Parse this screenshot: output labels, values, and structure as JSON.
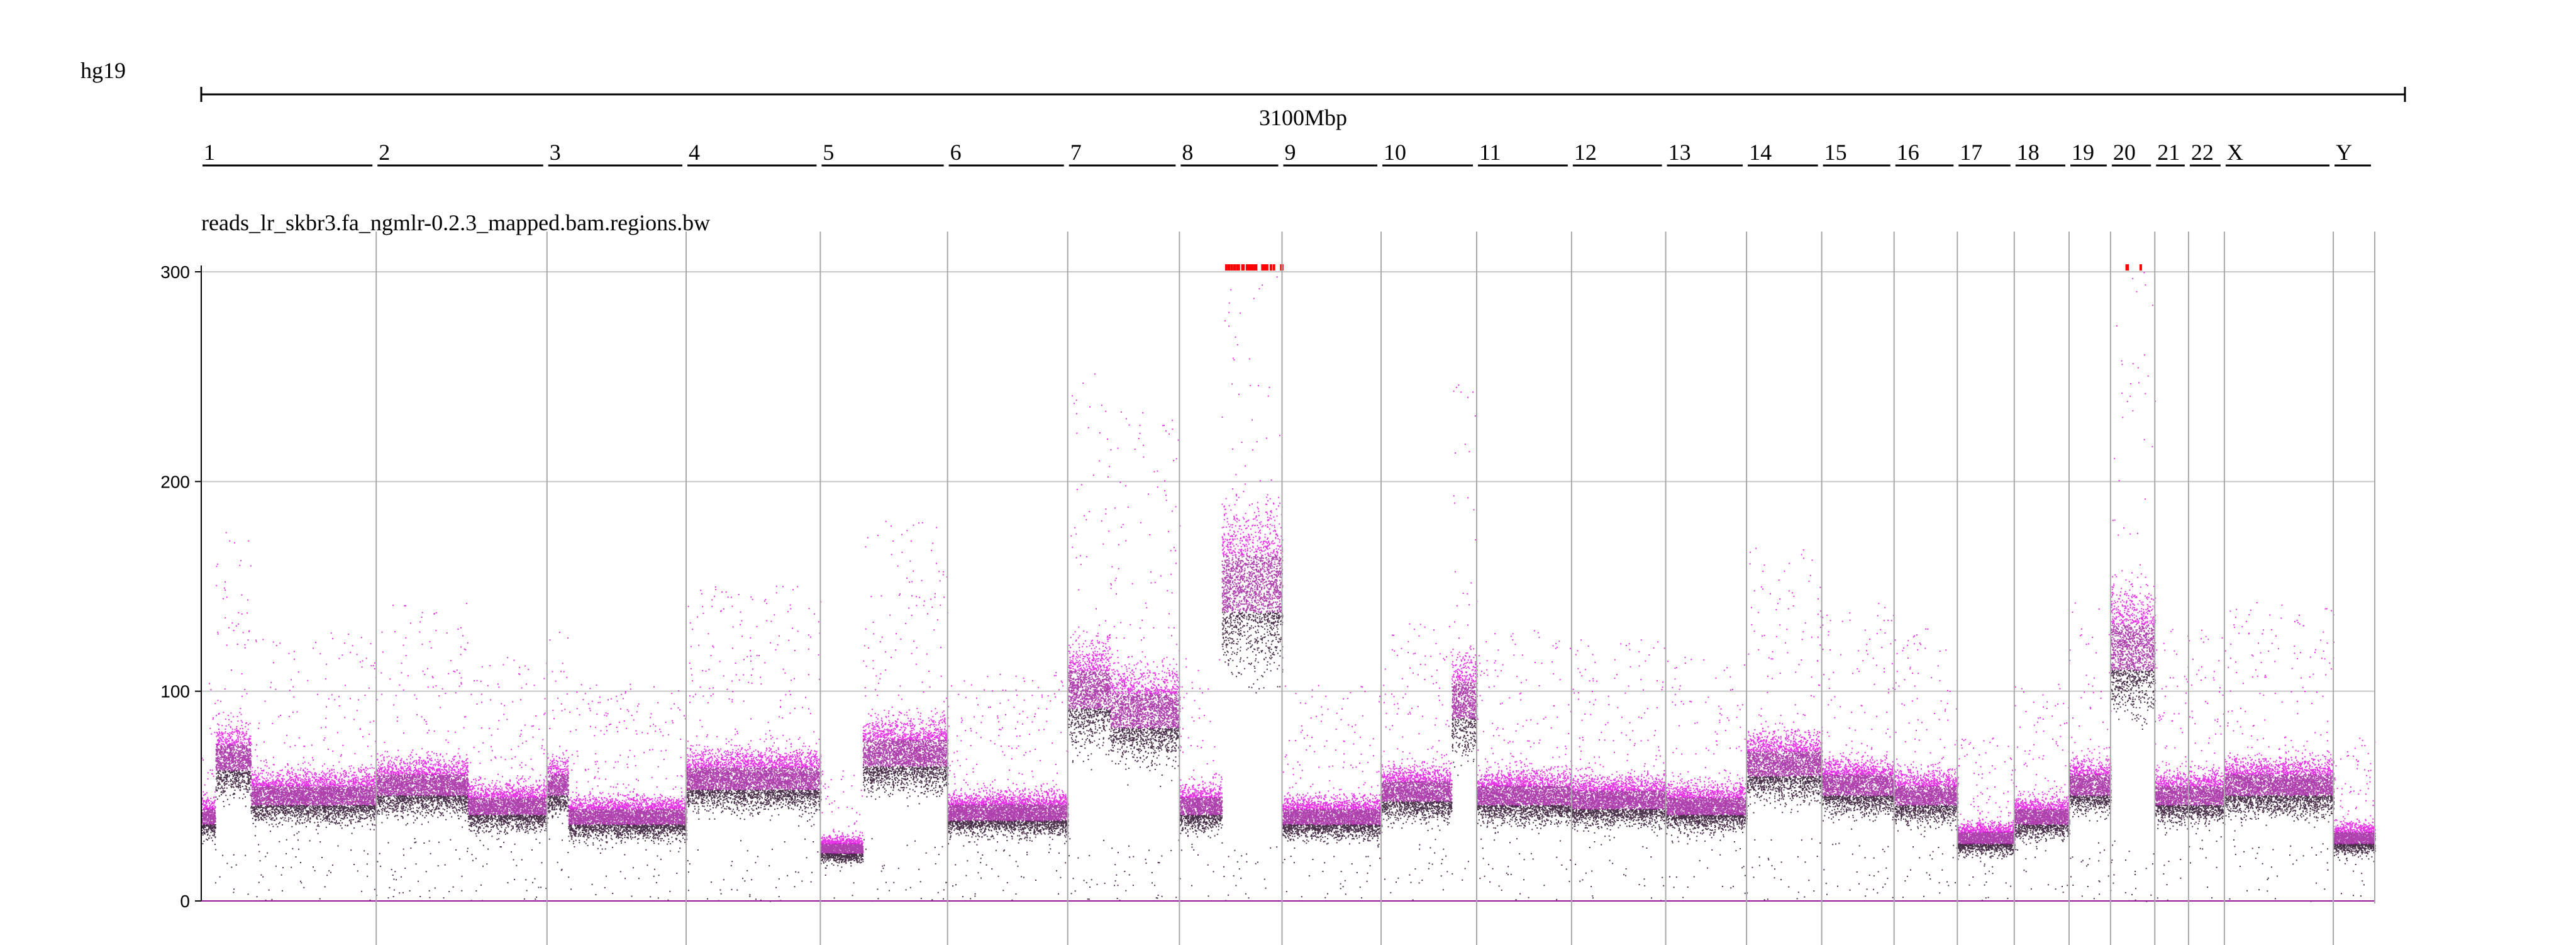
{
  "assembly": "hg19",
  "ruler": {
    "total_label": "3100Mbp"
  },
  "track": {
    "name": "reads_lr_skbr3.fa_ngmlr-0.2.3_mapped.bam.regions.bw"
  },
  "colors": {
    "signal_high": "#e000e0",
    "signal_mid": "#9a129a",
    "signal_low": "#2a0a2a",
    "clipped": "#ff0000",
    "grid": "#c8c8c8",
    "divider": "#a8a8a8",
    "axis": "#000000"
  },
  "chart_data": {
    "type": "scatter",
    "title": "reads_lr_skbr3.fa_ngmlr-0.2.3_mapped.bam.regions.bw",
    "xlabel": "",
    "ylabel": "",
    "ylim": [
      0,
      300
    ],
    "y_ticks": [
      0,
      100,
      200,
      300
    ],
    "grid": true,
    "legend": "none",
    "genome_length_mbp": 3100,
    "chromosomes": [
      {
        "name": "1",
        "length_mbp": 249,
        "level_segments": [
          [
            0,
            20,
            40
          ],
          [
            20,
            70,
            68
          ],
          [
            70,
            249,
            50
          ]
        ]
      },
      {
        "name": "2",
        "length_mbp": 243,
        "level_segments": [
          [
            0,
            130,
            55
          ],
          [
            130,
            243,
            45
          ]
        ]
      },
      {
        "name": "3",
        "length_mbp": 198,
        "level_segments": [
          [
            0,
            30,
            55
          ],
          [
            30,
            198,
            40
          ]
        ]
      },
      {
        "name": "4",
        "length_mbp": 191,
        "level_segments": [
          [
            0,
            191,
            58
          ]
        ]
      },
      {
        "name": "5",
        "length_mbp": 181,
        "level_segments": [
          [
            0,
            60,
            25
          ],
          [
            60,
            181,
            70
          ]
        ]
      },
      {
        "name": "6",
        "length_mbp": 171,
        "level_segments": [
          [
            0,
            171,
            42
          ]
        ]
      },
      {
        "name": "7",
        "length_mbp": 159,
        "level_segments": [
          [
            0,
            60,
            100
          ],
          [
            60,
            159,
            90
          ]
        ]
      },
      {
        "name": "8",
        "length_mbp": 146,
        "level_segments": [
          [
            0,
            60,
            45
          ],
          [
            60,
            146,
            150
          ]
        ]
      },
      {
        "name": "9",
        "length_mbp": 141,
        "level_segments": [
          [
            0,
            141,
            40
          ]
        ]
      },
      {
        "name": "10",
        "length_mbp": 136,
        "level_segments": [
          [
            0,
            100,
            52
          ],
          [
            100,
            136,
            95
          ]
        ]
      },
      {
        "name": "11",
        "length_mbp": 135,
        "level_segments": [
          [
            0,
            135,
            50
          ]
        ]
      },
      {
        "name": "12",
        "length_mbp": 134,
        "level_segments": [
          [
            0,
            134,
            48
          ]
        ]
      },
      {
        "name": "13",
        "length_mbp": 115,
        "level_segments": [
          [
            0,
            115,
            45
          ]
        ]
      },
      {
        "name": "14",
        "length_mbp": 107,
        "level_segments": [
          [
            0,
            107,
            65
          ]
        ]
      },
      {
        "name": "15",
        "length_mbp": 103,
        "level_segments": [
          [
            0,
            103,
            55
          ]
        ]
      },
      {
        "name": "16",
        "length_mbp": 90,
        "level_segments": [
          [
            0,
            90,
            50
          ]
        ]
      },
      {
        "name": "17",
        "length_mbp": 81,
        "level_segments": [
          [
            0,
            81,
            30
          ]
        ]
      },
      {
        "name": "18",
        "length_mbp": 78,
        "level_segments": [
          [
            0,
            78,
            40
          ]
        ]
      },
      {
        "name": "19",
        "length_mbp": 59,
        "level_segments": [
          [
            0,
            59,
            55
          ]
        ]
      },
      {
        "name": "20",
        "length_mbp": 63,
        "level_segments": [
          [
            0,
            63,
            120
          ]
        ]
      },
      {
        "name": "21",
        "length_mbp": 48,
        "level_segments": [
          [
            0,
            48,
            50
          ]
        ]
      },
      {
        "name": "22",
        "length_mbp": 51,
        "level_segments": [
          [
            0,
            51,
            50
          ]
        ]
      },
      {
        "name": "X",
        "length_mbp": 155,
        "level_segments": [
          [
            0,
            155,
            55
          ]
        ]
      },
      {
        "name": "Y",
        "length_mbp": 59,
        "level_segments": [
          [
            0,
            59,
            30
          ]
        ]
      }
    ]
  }
}
